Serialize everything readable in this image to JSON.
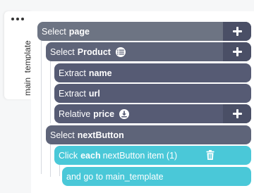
{
  "side_tab": {
    "label": "main_template"
  },
  "rows": [
    {
      "prefix": "Select",
      "keyword": "page"
    },
    {
      "prefix": "Select",
      "keyword": "Product"
    },
    {
      "prefix": "Extract",
      "keyword": "name"
    },
    {
      "prefix": "Extract",
      "keyword": "url"
    },
    {
      "prefix": "Relative",
      "keyword": "price"
    },
    {
      "prefix": "Select",
      "keyword": "nextButton"
    },
    {
      "prefix": "Click",
      "keyword": "each",
      "suffix": "nextButton item (1)"
    },
    {
      "text": "and go to main_template"
    }
  ],
  "icons": {
    "menu": "more-dots-icon",
    "add": "plus-icon",
    "list": "list-icon",
    "download": "download-icon",
    "delete": "trash-icon"
  },
  "colors": {
    "level1": "#6d7483",
    "level2": "#5e6479",
    "level3": "#565b74",
    "plus_button": "#4a4f66",
    "click_action": "#4ac8d8"
  }
}
